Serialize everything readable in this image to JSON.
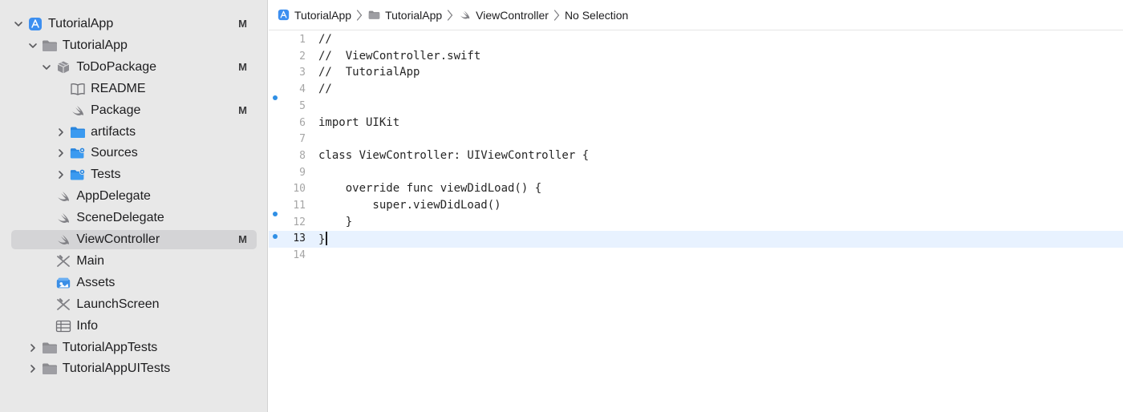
{
  "navigator": {
    "items": [
      {
        "label": "TutorialApp",
        "badge": "M",
        "icon": "app-project-icon",
        "disclosure": "expanded",
        "depth": 0
      },
      {
        "label": "TutorialApp",
        "badge": "",
        "icon": "folder-icon",
        "disclosure": "expanded",
        "depth": 1
      },
      {
        "label": "ToDoPackage",
        "badge": "M",
        "icon": "package-icon",
        "disclosure": "expanded",
        "depth": 2
      },
      {
        "label": "README",
        "badge": "",
        "icon": "book-icon",
        "disclosure": "none",
        "depth": 3
      },
      {
        "label": "Package",
        "badge": "M",
        "icon": "swift-icon",
        "disclosure": "none",
        "depth": 3
      },
      {
        "label": "artifacts",
        "badge": "",
        "icon": "blue-folder-icon",
        "disclosure": "collapsed",
        "depth": 3
      },
      {
        "label": "Sources",
        "badge": "",
        "icon": "source-folder-icon",
        "disclosure": "collapsed",
        "depth": 3
      },
      {
        "label": "Tests",
        "badge": "",
        "icon": "source-folder-icon",
        "disclosure": "collapsed",
        "depth": 3
      },
      {
        "label": "AppDelegate",
        "badge": "",
        "icon": "swift-icon",
        "disclosure": "none",
        "depth": 2
      },
      {
        "label": "SceneDelegate",
        "badge": "",
        "icon": "swift-icon",
        "disclosure": "none",
        "depth": 2
      },
      {
        "label": "ViewController",
        "badge": "M",
        "icon": "swift-icon",
        "disclosure": "none",
        "depth": 2,
        "selected": true
      },
      {
        "label": "Main",
        "badge": "",
        "icon": "storyboard-icon",
        "disclosure": "none",
        "depth": 2
      },
      {
        "label": "Assets",
        "badge": "",
        "icon": "assets-icon",
        "disclosure": "none",
        "depth": 2
      },
      {
        "label": "LaunchScreen",
        "badge": "",
        "icon": "storyboard-icon",
        "disclosure": "none",
        "depth": 2
      },
      {
        "label": "Info",
        "badge": "",
        "icon": "plist-table-icon",
        "disclosure": "none",
        "depth": 2
      },
      {
        "label": "TutorialAppTests",
        "badge": "",
        "icon": "folder-icon",
        "disclosure": "collapsed",
        "depth": 1
      },
      {
        "label": "TutorialAppUITests",
        "badge": "",
        "icon": "folder-icon",
        "disclosure": "collapsed",
        "depth": 1
      }
    ]
  },
  "jumpbar": {
    "crumbs": [
      {
        "label": "TutorialApp",
        "icon": "app-project-icon"
      },
      {
        "label": "TutorialApp",
        "icon": "folder-icon"
      },
      {
        "label": "ViewController",
        "icon": "swift-icon"
      },
      {
        "label": "No Selection",
        "icon": ""
      }
    ]
  },
  "editor": {
    "current_line": 13,
    "lines": [
      {
        "n": "1",
        "text": "//"
      },
      {
        "n": "2",
        "text": "//  ViewController.swift"
      },
      {
        "n": "3",
        "text": "//  TutorialApp"
      },
      {
        "n": "4",
        "text": "//"
      },
      {
        "n": "5",
        "text": ""
      },
      {
        "n": "6",
        "text": "import UIKit"
      },
      {
        "n": "7",
        "text": ""
      },
      {
        "n": "8",
        "text": "class ViewController: UIViewController {"
      },
      {
        "n": "9",
        "text": ""
      },
      {
        "n": "10",
        "text": "    override func viewDidLoad() {"
      },
      {
        "n": "11",
        "text": "        super.viewDidLoad()"
      },
      {
        "n": "12",
        "text": "    }"
      },
      {
        "n": "13",
        "text": "}"
      },
      {
        "n": "14",
        "text": ""
      }
    ],
    "changed_lines": [
      5,
      12,
      13
    ]
  },
  "colors": {
    "accent": "#2f8fe5",
    "sidebar_bg": "#e8e8e8",
    "selected_row": "#d4d4d6",
    "current_line_bg": "#e8f2ff"
  }
}
